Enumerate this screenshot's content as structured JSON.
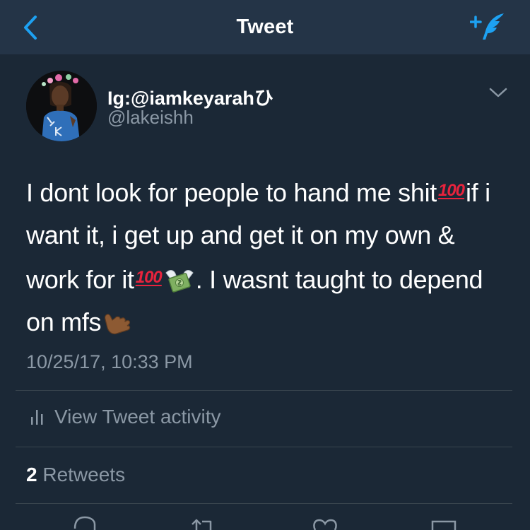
{
  "header": {
    "title": "Tweet",
    "back_icon": "chevron-left-icon",
    "compose_icon": "compose-tweet-icon",
    "accent_color": "#1da1f2"
  },
  "tweet": {
    "display_name": "Ig:@iamkeyarah",
    "display_name_suffix": "ひ",
    "handle": "@lakeishh",
    "text_parts": {
      "p1": "I dont look for people to hand me shit",
      "p2": "if i want it, i get up and get it on my own & work for it",
      "p3": ". I wasnt taught to depend on mfs"
    },
    "emojis": {
      "hundred": "100",
      "money_with_wings": "money-with-wings-icon",
      "call_me_hand": "call-me-hand-icon"
    },
    "timestamp": "10/25/17, 10:33 PM"
  },
  "activity": {
    "label": "View Tweet activity",
    "icon": "bar-chart-icon"
  },
  "stats": {
    "retweet_count": "2",
    "retweet_label": " Retweets"
  },
  "actions": [
    "reply-icon",
    "retweet-icon",
    "like-icon",
    "share-icon"
  ],
  "colors": {
    "background": "#1b2836",
    "header_background": "#243447",
    "secondary_text": "#8b98a5",
    "divider": "#38444d",
    "emoji_red": "#e8233d"
  }
}
